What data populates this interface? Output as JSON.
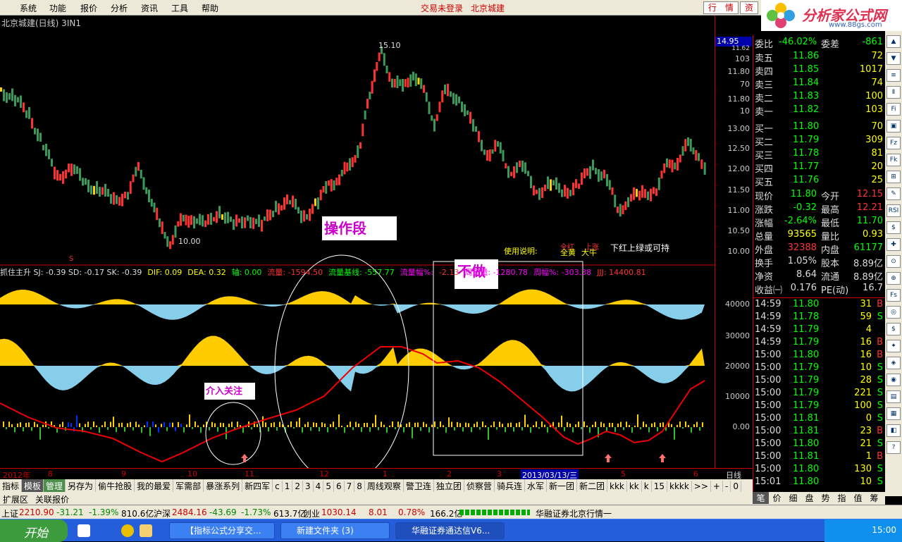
{
  "menu": {
    "items": [
      "系统",
      "功能",
      "报价",
      "分析",
      "资讯",
      "工具",
      "帮助"
    ],
    "status": "交易未登录",
    "stock_name": "北京城建",
    "tab1": "行　情",
    "tab2": "资"
  },
  "logo": {
    "text": "分析家公式网",
    "url": "www.88gs.com"
  },
  "chart": {
    "title": "北京城建(日线) 3IN1",
    "high_label": "15.10",
    "low_label": "10.00",
    "period": "日线",
    "s_marker": "S",
    "legend_top": {
      "l1": "全红",
      "l2": "上涨",
      "l3": "全黄",
      "l4": "大牛",
      "note": "使用说明:",
      "tip": "下红上绿或可持"
    },
    "scale_main": [
      "103",
      "11.80",
      "70",
      "11.80",
      "10",
      "13.00",
      "12.50",
      "12.00",
      "11.50",
      "11.00",
      "10.50",
      "10.00"
    ],
    "scale_top_box": "14.95",
    "scale_top_sub": "11.62",
    "scale_ind": [
      "40000",
      "30000",
      "20000",
      "10000",
      "0.00"
    ]
  },
  "indicator_bar": [
    "抓住主升 SJ: -0.39 SD: -0.17 SK: -0.39",
    "DIF: 0.09",
    "DEA: 0.32",
    "轴: 0.00",
    "流量: -1594.50",
    "流量基线: -557.77",
    "流量幅%:",
    "-2.13",
    "周流量: -1280.78",
    "周幅%: -303.38",
    "JJJ: 14400.81"
  ],
  "annotations": {
    "a1": "操作段",
    "a2": "不做",
    "a3": "介入关注"
  },
  "dates": {
    "d0": "2012年",
    "d1": "8",
    "d2": "9",
    "d3": "10",
    "d4": "11",
    "d5": "12",
    "d6": "1",
    "d7": "2",
    "d8": "3",
    "sel": "2013/03/13/三",
    "d9": "5",
    "d10": "6"
  },
  "tabs": [
    "指标",
    "模板",
    "管理",
    "另存为",
    "偷牛抢股",
    "我的最爱",
    "军需部",
    "暴涨系列",
    "新四军",
    "c",
    "1",
    "2",
    "3",
    "4",
    "5",
    "6",
    "7",
    "8",
    "周线观察",
    "警卫连",
    "独立团",
    "侦察营",
    "骑兵连",
    "水军",
    "新一团",
    "新二团",
    "kkk",
    "kk",
    "k",
    "15",
    "kkkk",
    ">>",
    "+",
    "-",
    "0"
  ],
  "subtabs": [
    "扩展区",
    "关联报价"
  ],
  "quote": {
    "sell_ratio": "委比",
    "sell_ratio_val": "-46.02%",
    "diff_label": "委差",
    "diff_val": "-861",
    "asks": [
      {
        "l": "卖五",
        "p": "11.86",
        "v": "72"
      },
      {
        "l": "卖四",
        "p": "11.85",
        "v": "1017"
      },
      {
        "l": "卖三",
        "p": "11.84",
        "v": "74"
      },
      {
        "l": "卖二",
        "p": "11.83",
        "v": "100"
      },
      {
        "l": "卖一",
        "p": "11.82",
        "v": "103"
      }
    ],
    "bids": [
      {
        "l": "买一",
        "p": "11.80",
        "v": "70"
      },
      {
        "l": "买二",
        "p": "11.79",
        "v": "309"
      },
      {
        "l": "买三",
        "p": "11.78",
        "v": "81"
      },
      {
        "l": "买四",
        "p": "11.77",
        "v": "20"
      },
      {
        "l": "买五",
        "p": "11.76",
        "v": "25"
      }
    ],
    "stats": [
      {
        "a": "现价",
        "av": "11.80",
        "b": "今开",
        "bv": "12.15"
      },
      {
        "a": "涨跌",
        "av": "-0.32",
        "b": "最高",
        "bv": "12.21"
      },
      {
        "a": "涨幅",
        "av": "-2.64%",
        "b": "最低",
        "bv": "11.70"
      },
      {
        "a": "总量",
        "av": "93565",
        "b": "量比",
        "bv": "0.93"
      },
      {
        "a": "外盘",
        "av": "32388",
        "b": "内盘",
        "bv": "61177"
      },
      {
        "a": "换手",
        "av": "1.05%",
        "b": "股本",
        "bv": "8.89亿"
      },
      {
        "a": "净资",
        "av": "8.64",
        "b": "流通",
        "bv": "8.89亿"
      },
      {
        "a": "收益㈠",
        "av": "0.176",
        "b": "PE(动)",
        "bv": "16.7"
      }
    ],
    "ticks": [
      {
        "t": "14:59",
        "p": "11.80",
        "v": "31",
        "s": "B"
      },
      {
        "t": "14:59",
        "p": "11.78",
        "v": "59",
        "s": "S"
      },
      {
        "t": "14:59",
        "p": "11.79",
        "v": "4",
        "s": ""
      },
      {
        "t": "14:59",
        "p": "11.79",
        "v": "16",
        "s": "B"
      },
      {
        "t": "15:00",
        "p": "11.80",
        "v": "16",
        "s": "B"
      },
      {
        "t": "15:00",
        "p": "11.79",
        "v": "10",
        "s": "S"
      },
      {
        "t": "15:00",
        "p": "11.79",
        "v": "28",
        "s": "S"
      },
      {
        "t": "15:00",
        "p": "11.79",
        "v": "221",
        "s": "S"
      },
      {
        "t": "15:00",
        "p": "11.79",
        "v": "100",
        "s": "S"
      },
      {
        "t": "15:00",
        "p": "11.81",
        "v": "0",
        "s": "S"
      },
      {
        "t": "15:00",
        "p": "11.81",
        "v": "23",
        "s": "B"
      },
      {
        "t": "15:00",
        "p": "11.80",
        "v": "21",
        "s": "S"
      },
      {
        "t": "15:00",
        "p": "11.81",
        "v": "1",
        "s": "B"
      },
      {
        "t": "15:00",
        "p": "11.80",
        "v": "130",
        "s": "S"
      },
      {
        "t": "15:01",
        "p": "11.80",
        "v": "10",
        "s": "S"
      }
    ],
    "ptabs": [
      "笔",
      "价",
      "细",
      "盘",
      "势",
      "指",
      "值",
      "筹"
    ]
  },
  "status": {
    "sh": "上证",
    "sh_v": "2210.90",
    "sh_c": "-31.21",
    "sh_p": "-1.39%",
    "sh_a": "810.6亿",
    "sz": "沪深",
    "sz_v": "2484.16",
    "sz_c": "-43.69",
    "sz_p": "-1.73%",
    "sz_a": "613.7亿",
    "cy": "创业",
    "cy_v": "1030.14",
    "cy_c": "8.01",
    "cy_p": "0.78%",
    "cy_a": "166.2亿",
    "broker": "华融证券北京行情一"
  },
  "taskbar": {
    "start": "开始",
    "t1": "【指标公式分享交...",
    "t2": "新建文件夹  (3)",
    "t3": "华融证券通达信V6...",
    "clock": "15:00"
  },
  "colors": {
    "up": "#ff3333",
    "down": "#2e8b57",
    "yellow": "#ffcc00",
    "blue": "#87ceeb"
  }
}
